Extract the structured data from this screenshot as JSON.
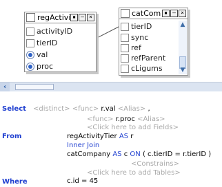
{
  "tables": {
    "reg": {
      "title": "regActivi",
      "fields": [
        {
          "name": "activityID",
          "selected": false
        },
        {
          "name": "tierID",
          "selected": false
        },
        {
          "name": "val",
          "selected": true
        },
        {
          "name": "proc",
          "selected": true
        }
      ]
    },
    "cat": {
      "title": "catComp",
      "fields": [
        {
          "name": "tierID",
          "selected": false
        },
        {
          "name": "sync",
          "selected": false
        },
        {
          "name": "ref",
          "selected": false
        },
        {
          "name": "refParent",
          "selected": false
        },
        {
          "name": "cLigums",
          "selected": false
        }
      ]
    }
  },
  "window_buttons": {
    "restore": "▪",
    "minimize": "–",
    "close": "×"
  },
  "sql": {
    "select_kw": "Select",
    "distinct": "<distinct>",
    "func1": "<func>",
    "expr1": "r.val",
    "alias1": "<Alias>",
    "comma": ",",
    "func2": "<func>",
    "expr2": "r.proc",
    "alias2": "<Alias>",
    "add_fields": "<Click here to add Fields>",
    "from_kw": "From",
    "table1": "regActivityTier",
    "as1": "AS",
    "alias_r": "r",
    "join": "Inner Join",
    "table2": "catCompany",
    "as2": "AS",
    "alias_c": "c",
    "on_kw": "ON",
    "join_cond": "( c.tierID = r.tierID )",
    "constraints": "<Constrains>",
    "add_tables": "<Click here to add Tables>",
    "where_kw": "Where",
    "where_cond": "c.id = 45"
  },
  "icons": {
    "scroll_left": "chevron-left-icon",
    "scroll_up": "arrow-up-icon",
    "scroll_down": "arrow-down-icon"
  }
}
